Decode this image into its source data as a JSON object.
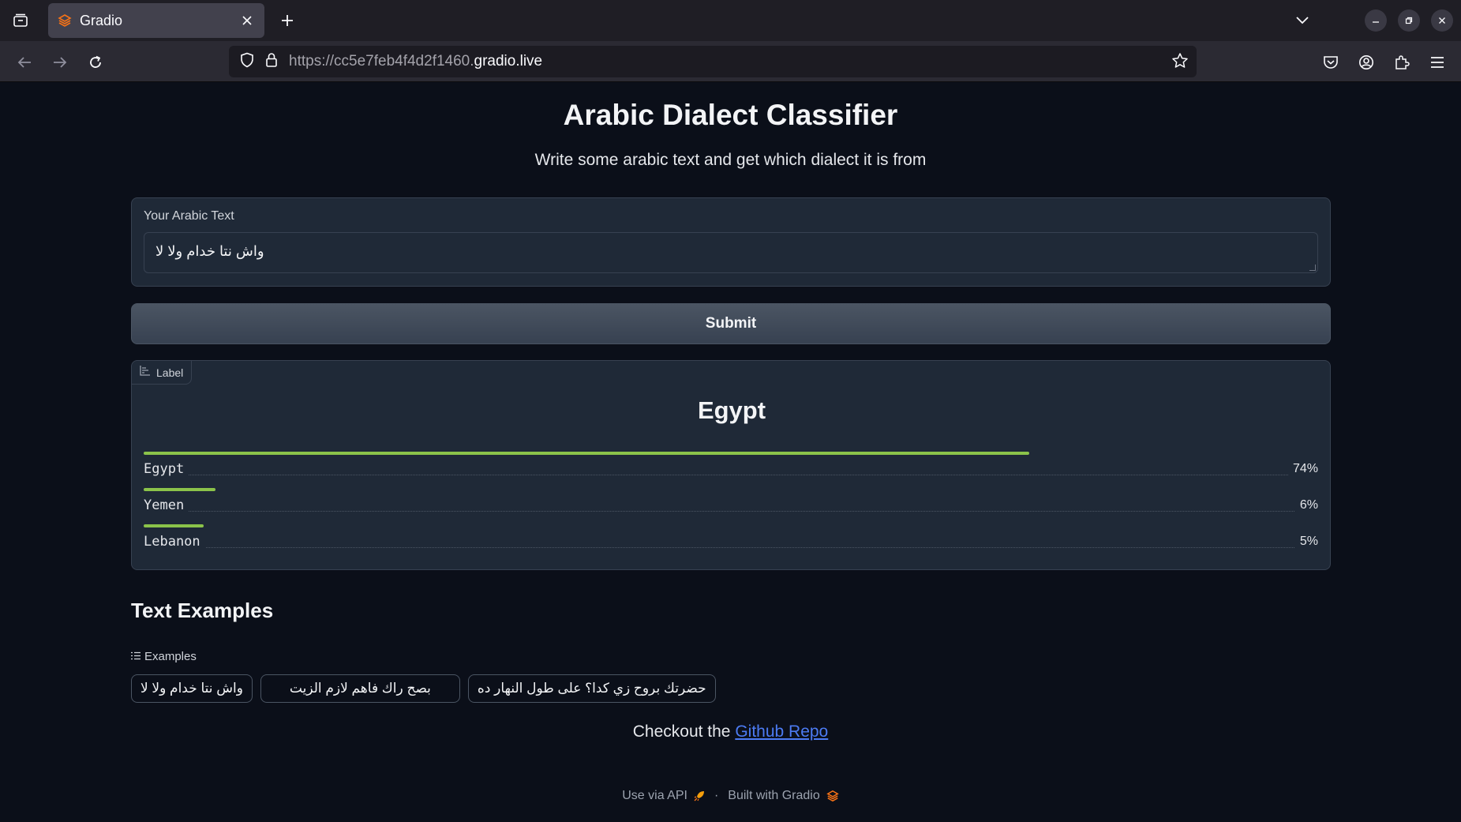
{
  "browser": {
    "tab_title": "Gradio",
    "url_prefix": "https://cc5e7feb4f4d2f1460.",
    "url_domain": "gradio.live"
  },
  "app": {
    "title": "Arabic Dialect Classifier",
    "description": "Write some arabic text and get which dialect it is from"
  },
  "input": {
    "label": "Your Arabic Text",
    "value": "واش نتا خدام ولا لا"
  },
  "submit_label": "Submit",
  "output": {
    "chip_label": "Label",
    "top_label": "Egypt",
    "confidences": [
      {
        "label": "Egypt",
        "value": 0.74,
        "display": "74%"
      },
      {
        "label": "Yemen",
        "value": 0.06,
        "display": "6%"
      },
      {
        "label": "Lebanon",
        "value": 0.05,
        "display": "5%"
      }
    ]
  },
  "examples": {
    "heading": "Text Examples",
    "label": "Examples",
    "items": [
      "واش نتا خدام ولا لا",
      "بصح راك فاهم لازم الزيت",
      "حضرتك بروح زي كدا؟ على طول النهار ده"
    ]
  },
  "note": {
    "prefix": "Checkout the ",
    "link": "Github Repo"
  },
  "footer": {
    "api": "Use via API",
    "separator": "·",
    "built": "Built with Gradio"
  },
  "colors": {
    "background": "#0b0f19",
    "panel": "#1f2937",
    "bar": "#8bc34a",
    "link": "#4c7bf3"
  }
}
